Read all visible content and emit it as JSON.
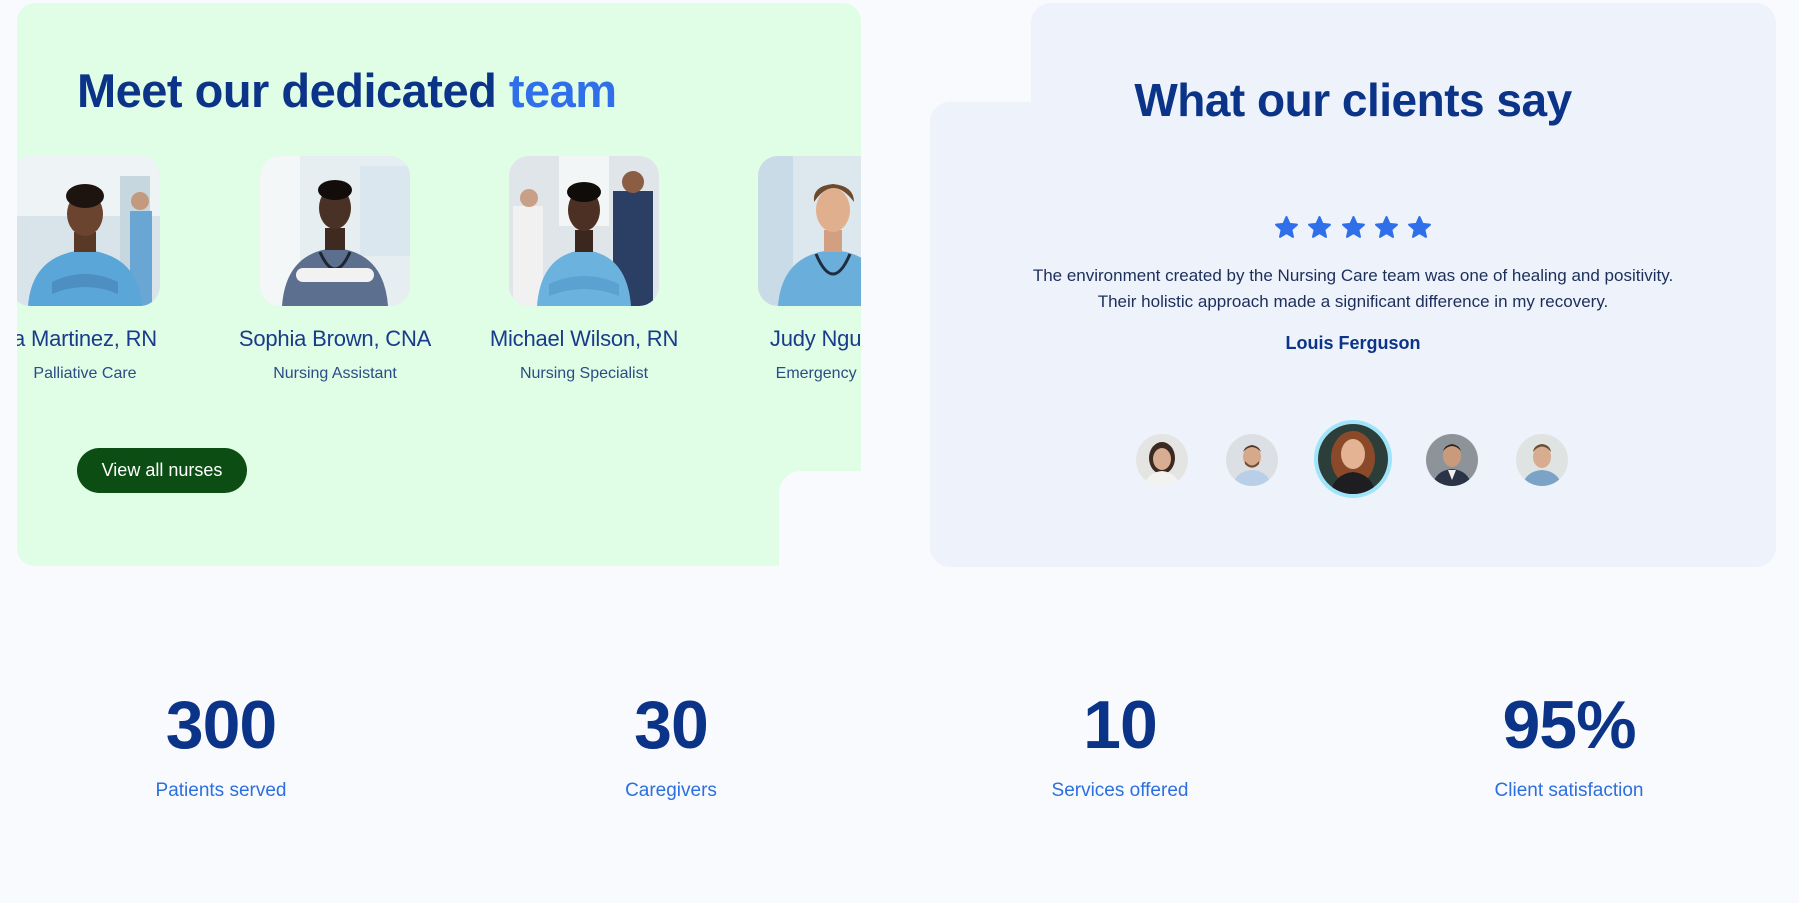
{
  "team": {
    "title_main": "Meet our dedicated",
    "title_accent": "team",
    "nurses": [
      {
        "name": "a Martinez, RN",
        "role": "Palliative Care"
      },
      {
        "name": "Sophia Brown, CNA",
        "role": "Nursing Assistant"
      },
      {
        "name": "Michael Wilson, RN",
        "role": "Nursing Specialist"
      },
      {
        "name": "Judy Nguyen",
        "role": "Emergency Roo"
      }
    ],
    "view_all_label": "View all nurses"
  },
  "testimonials": {
    "title": "What our clients say",
    "rating": 5,
    "quote_line1": "The environment created by the Nursing Care team was one of healing and positivity.",
    "quote_line2": "Their holistic approach made a significant difference in my recovery.",
    "author": "Louis Ferguson",
    "active_avatar_index": 2
  },
  "stats": [
    {
      "value": "300",
      "label": "Patients served"
    },
    {
      "value": "30",
      "label": "Caregivers"
    },
    {
      "value": "10",
      "label": "Services offered"
    },
    {
      "value": "95%",
      "label": "Client satisfaction"
    }
  ],
  "colors": {
    "brand_navy": "#0b3489",
    "brand_blue": "#2f6fe9",
    "button_green": "#0b4d13",
    "team_bg": "#e0fde5",
    "testimonial_bg": "#edf2fb",
    "star": "#2f6fe9"
  }
}
